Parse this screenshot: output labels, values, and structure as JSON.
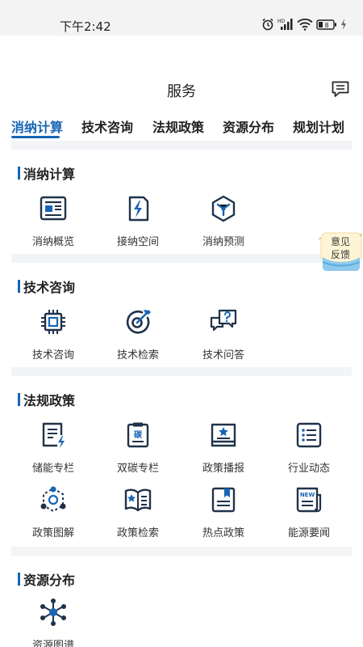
{
  "status_bar": {
    "time": "下午2:42",
    "battery": "8"
  },
  "header": {
    "title": "服务"
  },
  "tabs": [
    {
      "label": "消纳计算",
      "active": true
    },
    {
      "label": "技术咨询",
      "active": false
    },
    {
      "label": "法规政策",
      "active": false
    },
    {
      "label": "资源分布",
      "active": false
    },
    {
      "label": "规划计划",
      "active": false
    }
  ],
  "sections": [
    {
      "title": "消纳计算",
      "items": [
        {
          "label": "消纳概览",
          "icon": "newspaper-icon"
        },
        {
          "label": "接纳空间",
          "icon": "power-bolt-icon"
        },
        {
          "label": "消纳预测",
          "icon": "cube-network-icon"
        }
      ]
    },
    {
      "title": "技术咨询",
      "items": [
        {
          "label": "技术咨询",
          "icon": "chip-icon"
        },
        {
          "label": "技术检索",
          "icon": "target-arrow-icon"
        },
        {
          "label": "技术问答",
          "icon": "chat-question-icon"
        }
      ]
    },
    {
      "title": "法规政策",
      "items": [
        {
          "label": "储能专栏",
          "icon": "document-bolt-icon"
        },
        {
          "label": "双碳专栏",
          "icon": "clipboard-carbon-icon"
        },
        {
          "label": "政策播报",
          "icon": "book-star-icon"
        },
        {
          "label": "行业动态",
          "icon": "list-icon"
        },
        {
          "label": "政策图解",
          "icon": "hexagon-network-icon"
        },
        {
          "label": "政策检索",
          "icon": "open-book-star-icon"
        },
        {
          "label": "热点政策",
          "icon": "document-bookmark-icon"
        },
        {
          "label": "能源要闻",
          "icon": "news-icon"
        }
      ]
    },
    {
      "title": "资源分布",
      "items": [
        {
          "label": "资源图谱",
          "icon": "network-graph-icon"
        }
      ]
    }
  ],
  "feedback": {
    "line1": "意见",
    "line2": "反馈"
  },
  "icons": {
    "carbon_glyph": "碳",
    "news_glyph": "NEW"
  },
  "colors": {
    "accent": "#1765b5",
    "icon_dark": "#20324a"
  }
}
